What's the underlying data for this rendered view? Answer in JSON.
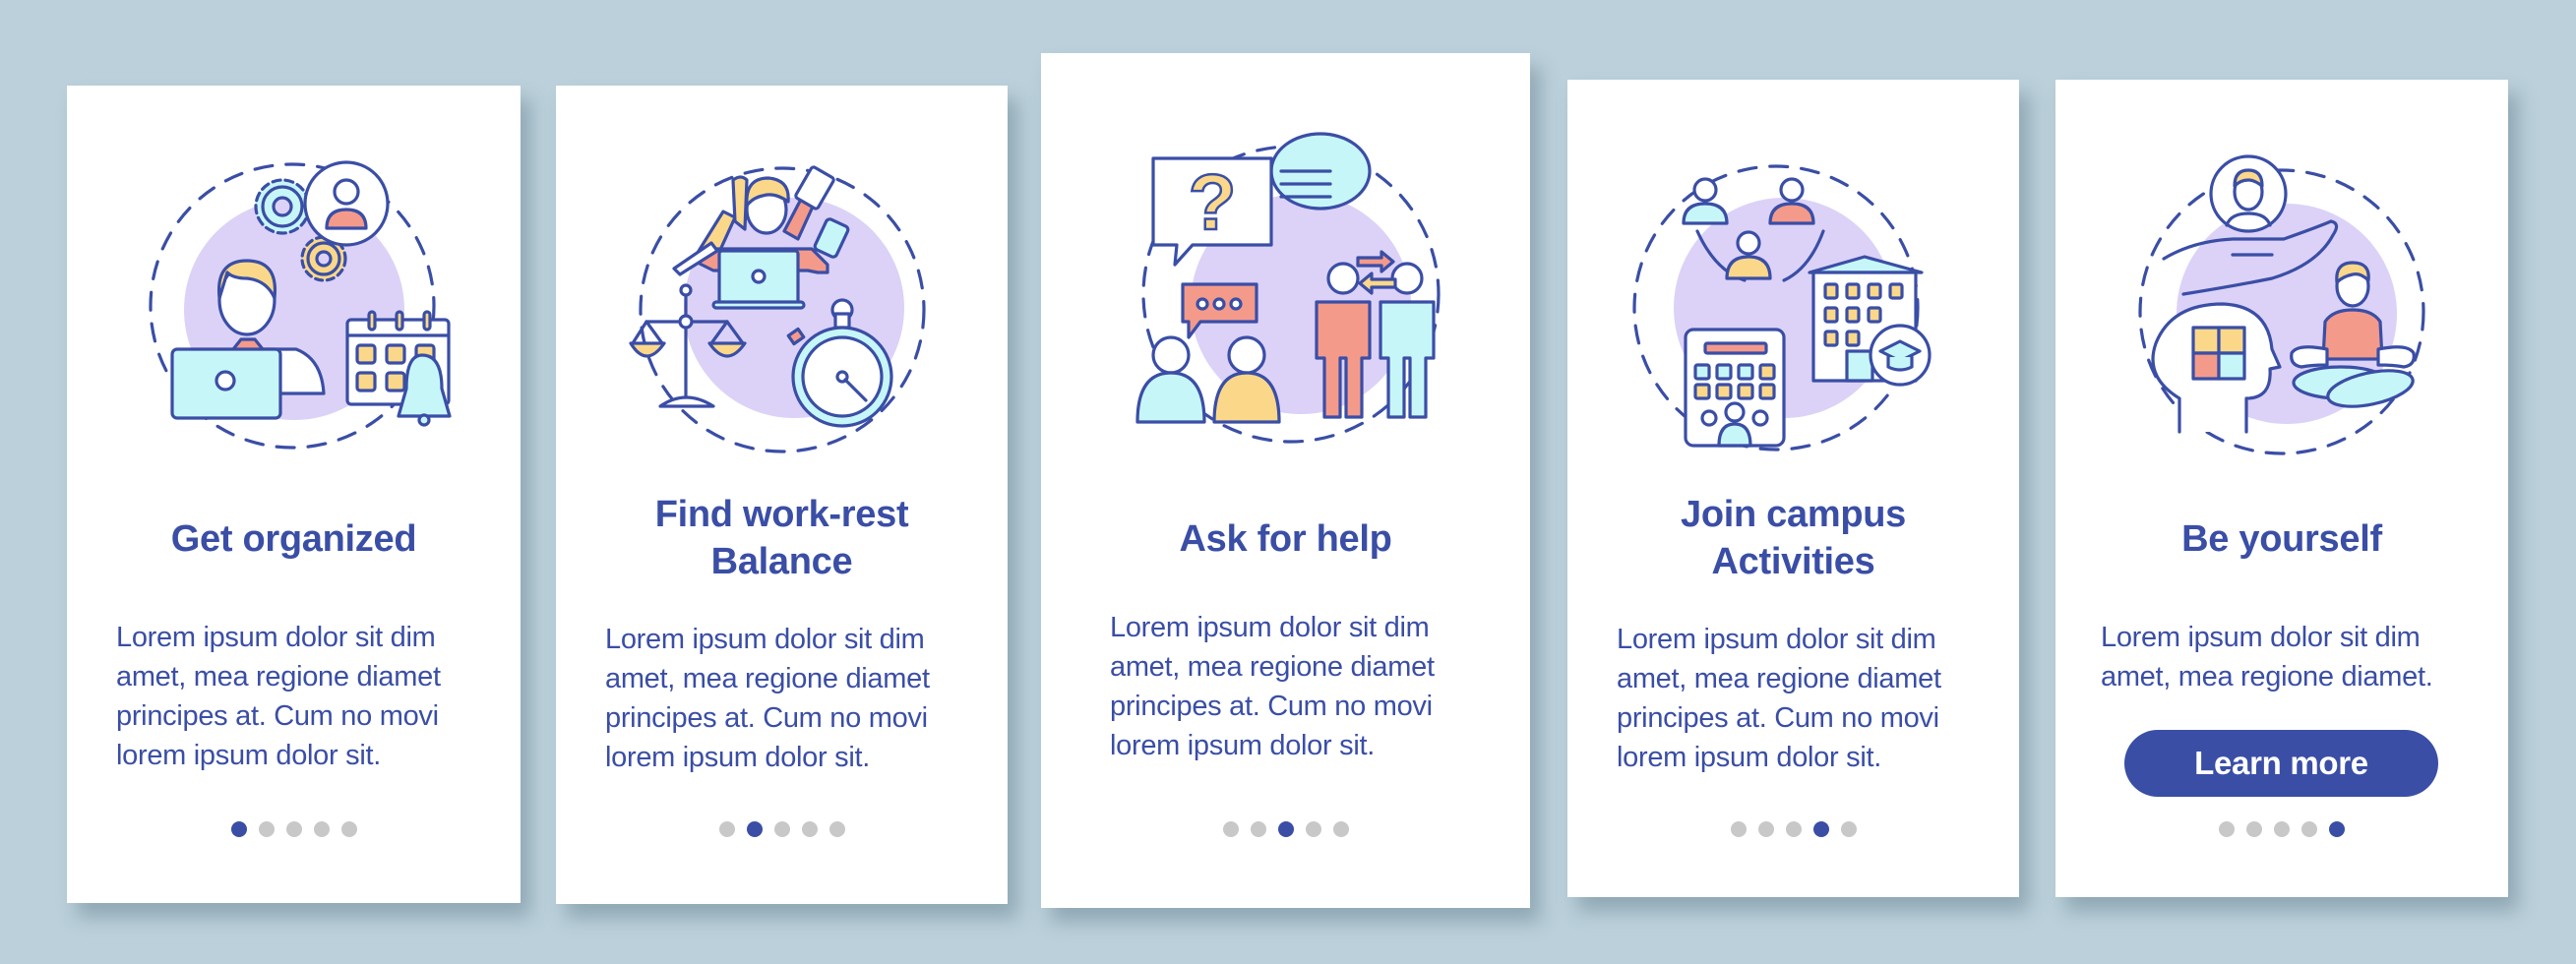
{
  "colors": {
    "background": "#bbd0da",
    "card": "#ffffff",
    "primary": "#3a4ea6",
    "lavender": "#dcd2f7",
    "yellow": "#fbd889",
    "cyan": "#c7f6f8",
    "coral": "#f49a8a",
    "dot_inactive": "#c8c8c8"
  },
  "pagination": {
    "total": 5
  },
  "screens": [
    {
      "illustration": "person-organizing-schedule-illustration",
      "title_lines": [
        "Get organized"
      ],
      "body_lines": [
        "Lorem ipsum dolor sit dim",
        "amet, mea regione diamet",
        "principes at. Cum no movi",
        "lorem ipsum dolor sit."
      ],
      "active_page": 1
    },
    {
      "illustration": "work-rest-balance-illustration",
      "title_lines": [
        "Find work-rest",
        "Balance"
      ],
      "body_lines": [
        "Lorem ipsum dolor sit dim",
        "amet, mea regione diamet",
        "principes at. Cum no movi",
        "lorem ipsum dolor sit."
      ],
      "active_page": 2
    },
    {
      "illustration": "ask-for-help-conversation-illustration",
      "title_lines": [
        "Ask for help"
      ],
      "body_lines": [
        "Lorem ipsum dolor sit dim",
        "amet, mea regione diamet",
        "principes at. Cum no movi",
        "lorem ipsum dolor sit."
      ],
      "active_page": 3
    },
    {
      "illustration": "campus-activities-illustration",
      "title_lines": [
        "Join campus",
        "Activities"
      ],
      "body_lines": [
        "Lorem ipsum dolor sit dim",
        "amet, mea regione diamet",
        "principes at. Cum no movi",
        "lorem ipsum dolor sit."
      ],
      "active_page": 4
    },
    {
      "illustration": "be-yourself-illustration",
      "title_lines": [
        "Be yourself"
      ],
      "body_lines": [
        "Lorem ipsum dolor sit dim",
        "amet, mea regione diamet."
      ],
      "button_label": "Learn more",
      "active_page": 5
    }
  ]
}
